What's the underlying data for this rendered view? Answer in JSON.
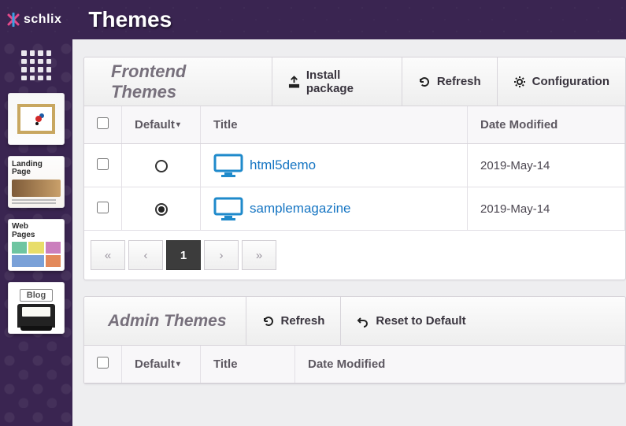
{
  "brand": "schlix",
  "page_title": "Themes",
  "sidebar": {
    "thumbs": [
      {
        "name": "art-thumb"
      },
      {
        "name": "landing-page-thumb",
        "label1": "Landing",
        "label2": "Page"
      },
      {
        "name": "web-pages-thumb",
        "label1": "Web",
        "label2": "Pages"
      },
      {
        "name": "blog-thumb",
        "label": "Blog"
      }
    ]
  },
  "panels": {
    "frontend": {
      "title": "Frontend Themes",
      "actions": {
        "install": "Install package",
        "refresh": "Refresh",
        "config": "Configuration"
      },
      "columns": {
        "default": "Default",
        "title": "Title",
        "date": "Date Modified"
      },
      "rows": [
        {
          "default": false,
          "title": "html5demo",
          "date": "2019-May-14"
        },
        {
          "default": true,
          "title": "samplemagazine",
          "date": "2019-May-14"
        }
      ],
      "pager": {
        "current": "1"
      }
    },
    "admin": {
      "title": "Admin Themes",
      "actions": {
        "refresh": "Refresh",
        "reset": "Reset to Default"
      },
      "columns": {
        "default": "Default",
        "title": "Title",
        "date": "Date Modified"
      }
    }
  }
}
